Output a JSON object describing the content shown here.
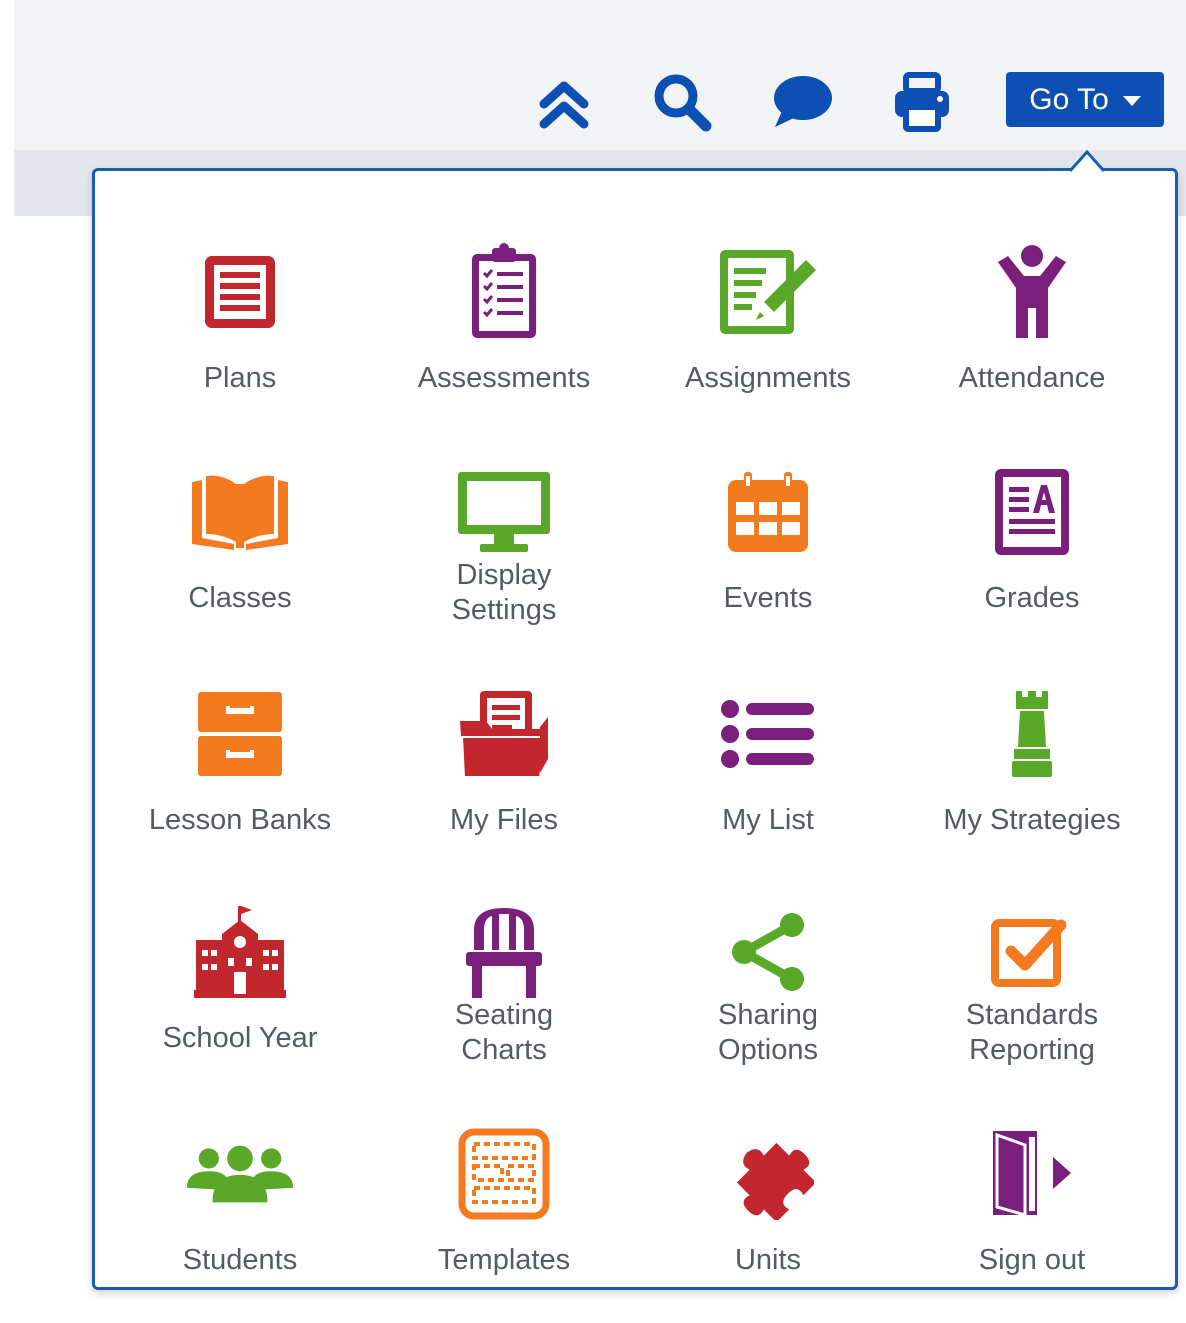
{
  "toolbar": {
    "collapse_icon": "double-chevron-up-icon",
    "search_icon": "search-icon",
    "chat_icon": "chat-bubble-icon",
    "print_icon": "printer-icon",
    "goto_label": "Go To"
  },
  "menu": {
    "items": [
      {
        "label": "Plans",
        "icon": "plans-icon",
        "color": "#c1272d"
      },
      {
        "label": "Assessments",
        "icon": "clipboard-checklist-icon",
        "color": "#7b1f7d"
      },
      {
        "label": "Assignments",
        "icon": "pencil-document-icon",
        "color": "#5aa829"
      },
      {
        "label": "Attendance",
        "icon": "person-raised-arms-icon",
        "color": "#7b1f7d"
      },
      {
        "label": "Classes",
        "icon": "open-book-icon",
        "color": "#f47a20"
      },
      {
        "label": "Display\nSettings",
        "icon": "monitor-icon",
        "color": "#5aa829"
      },
      {
        "label": "Events",
        "icon": "calendar-icon",
        "color": "#f47a20"
      },
      {
        "label": "Grades",
        "icon": "grade-document-icon",
        "color": "#7b1f7d"
      },
      {
        "label": "Lesson Banks",
        "icon": "file-cabinet-icon",
        "color": "#f47a20"
      },
      {
        "label": "My Files",
        "icon": "folder-icon",
        "color": "#c1272d"
      },
      {
        "label": "My List",
        "icon": "list-icon",
        "color": "#7b1f7d"
      },
      {
        "label": "My Strategies",
        "icon": "chess-rook-icon",
        "color": "#5aa829"
      },
      {
        "label": "School Year",
        "icon": "school-building-icon",
        "color": "#c1272d"
      },
      {
        "label": "Seating\nCharts",
        "icon": "chair-icon",
        "color": "#7b1f7d"
      },
      {
        "label": "Sharing\nOptions",
        "icon": "share-icon",
        "color": "#5aa829"
      },
      {
        "label": "Standards\nReporting",
        "icon": "checkbox-icon",
        "color": "#f47a20"
      },
      {
        "label": "Students",
        "icon": "group-icon",
        "color": "#5aa829"
      },
      {
        "label": "Templates",
        "icon": "template-icon",
        "color": "#f47a20"
      },
      {
        "label": "Units",
        "icon": "puzzle-piece-icon",
        "color": "#c1272d"
      },
      {
        "label": "Sign out",
        "icon": "exit-door-icon",
        "color": "#7b1f7d"
      }
    ]
  },
  "colors": {
    "toolbar_icon": "#0d4fb3",
    "goto_bg": "#0d4fb3",
    "panel_border": "#1c5db4",
    "label_text": "#555b63"
  }
}
